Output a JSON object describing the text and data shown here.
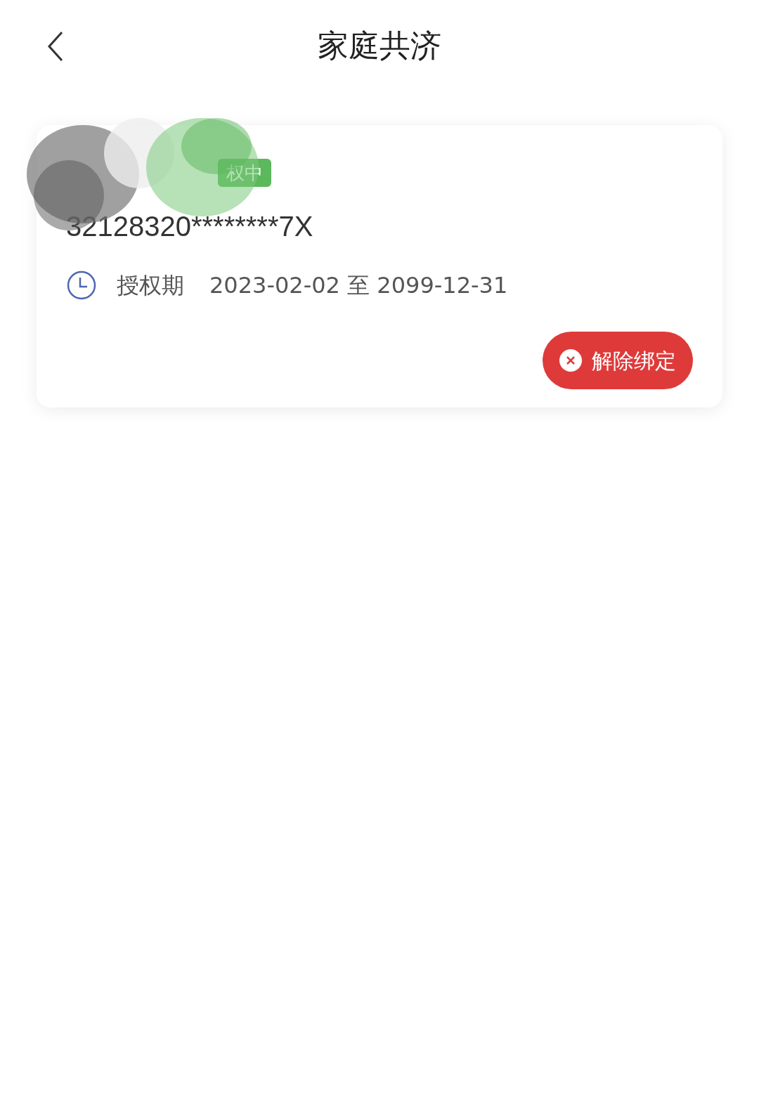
{
  "header": {
    "title": "家庭共济"
  },
  "card": {
    "badge": "权中",
    "id_number": "32128320********7X",
    "period_label": "授权期",
    "period_value": "2023-02-02 至 2099-12-31",
    "button": "解除绑定"
  }
}
